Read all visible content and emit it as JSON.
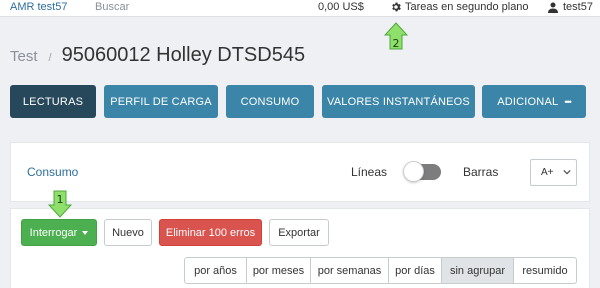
{
  "topbar": {
    "brand": "AMR test57",
    "search": "Buscar",
    "balance": "0,00 US$",
    "tasks": "Tareas en segundo plano",
    "user": "test57"
  },
  "header": {
    "breadcrumb": "Test",
    "separator": "/",
    "title": "95060012 Holley DTSD545"
  },
  "tabs": [
    {
      "label": "LECTURAS",
      "active": true
    },
    {
      "label": "PERFIL DE CARGA",
      "active": false
    },
    {
      "label": "CONSUMO",
      "active": false
    },
    {
      "label": "VALORES INSTANTÁNEOS",
      "active": false
    },
    {
      "label": "ADICIONAL",
      "active": false,
      "more": "•••"
    }
  ],
  "consumo": {
    "title": "Consumo",
    "lineas_label": "Líneas",
    "barras_label": "Barras",
    "font_select": "A+"
  },
  "actions": {
    "interrogar": "Interrogar",
    "nuevo": "Nuevo",
    "eliminar": "Eliminar 100 erros",
    "exportar": "Exportar"
  },
  "grouping": [
    {
      "label": "por años",
      "active": false
    },
    {
      "label": "por meses",
      "active": false
    },
    {
      "label": "por semanas",
      "active": false
    },
    {
      "label": "por días",
      "active": false
    },
    {
      "label": "sin agrupar",
      "active": true
    },
    {
      "label": "resumido",
      "active": false
    }
  ],
  "annotations": {
    "marker1": "1",
    "marker2": "2"
  },
  "colors": {
    "tab": "#3b86a8",
    "tab_active": "#26485a",
    "green": "#4caf50",
    "red": "#d9534f",
    "link": "#2f6f9e",
    "arrow": "#8ee06a"
  }
}
